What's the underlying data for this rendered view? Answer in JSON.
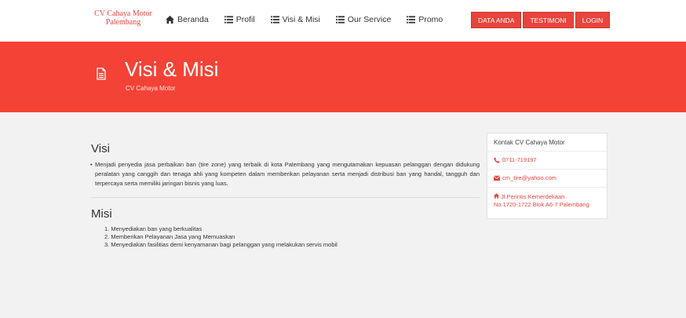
{
  "brand": {
    "line1": "CV Cahaya Motor",
    "line2": "Palembang"
  },
  "nav": {
    "items": [
      {
        "label": "Beranda",
        "icon": "home-icon"
      },
      {
        "label": "Profil",
        "icon": "list-icon"
      },
      {
        "label": "Visi & Misi",
        "icon": "list-icon"
      },
      {
        "label": "Our Service",
        "icon": "list-icon"
      },
      {
        "label": "Promo",
        "icon": "list-icon"
      }
    ],
    "buttons": [
      "DATA ANDA",
      "TESTIMONI",
      "LOGIN"
    ]
  },
  "hero": {
    "title": "Visi & Misi",
    "subtitle": "CV Cahaya Motor"
  },
  "visi": {
    "title": "Visi",
    "text": "Menjadi penyedia jasa perbaikan ban (tire zone) yang terbaik di kota Palembang yang mengutamakan kepuasan pelanggan dengan didukung peralatan yang canggih dan tenaga ahli yang kompeten dalam memberikan pelayanan serta menjadi distribusi ban yang handal, tangguh dan terpercaya serta memiliki jaringan bisnis yang luas."
  },
  "misi": {
    "title": "Misi",
    "items": [
      "1. Menyediakan ban yang berkualitas",
      "2. Memberikan Pelayanan Jasa yang Memuaskan",
      "3. Menyediakan fasilitias demi kenyamanan bagi pelanggan yang melakukan servis mobil"
    ]
  },
  "contact": {
    "title": "Kontak CV Cahaya Motor",
    "phone": "0711-719197",
    "email": "cm_tire@yahoo.com",
    "address_line1": "Jl.Perintis Kemerdekaan",
    "address_line2": "No.1720-1722 Blok A6-7 Palembang"
  },
  "colors": {
    "accent": "#f44336",
    "button": "#e8453c",
    "background": "#f2f2f2"
  }
}
